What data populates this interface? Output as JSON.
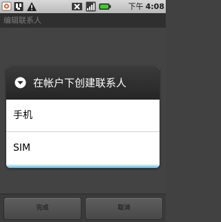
{
  "status_bar": {
    "icons": [
      "messaging-icon",
      "usb-debug-icon",
      "warning-icon",
      "sim-signal-off-icon",
      "signal-bars-icon",
      "battery-icon"
    ],
    "time_period": "下午",
    "time": "4:08"
  },
  "title_bar": {
    "title": "编辑联系人"
  },
  "dialog": {
    "title": "在帐户下创建联系人",
    "icon": "chevron-down-circle-icon",
    "options": [
      {
        "label": "手机"
      },
      {
        "label": "SIM"
      }
    ]
  },
  "buttons": {
    "done": "完成",
    "cancel": "取消"
  },
  "colors": {
    "accent": "#49b8de",
    "battery": "#3ecc2a",
    "warning": "#ffd000"
  }
}
